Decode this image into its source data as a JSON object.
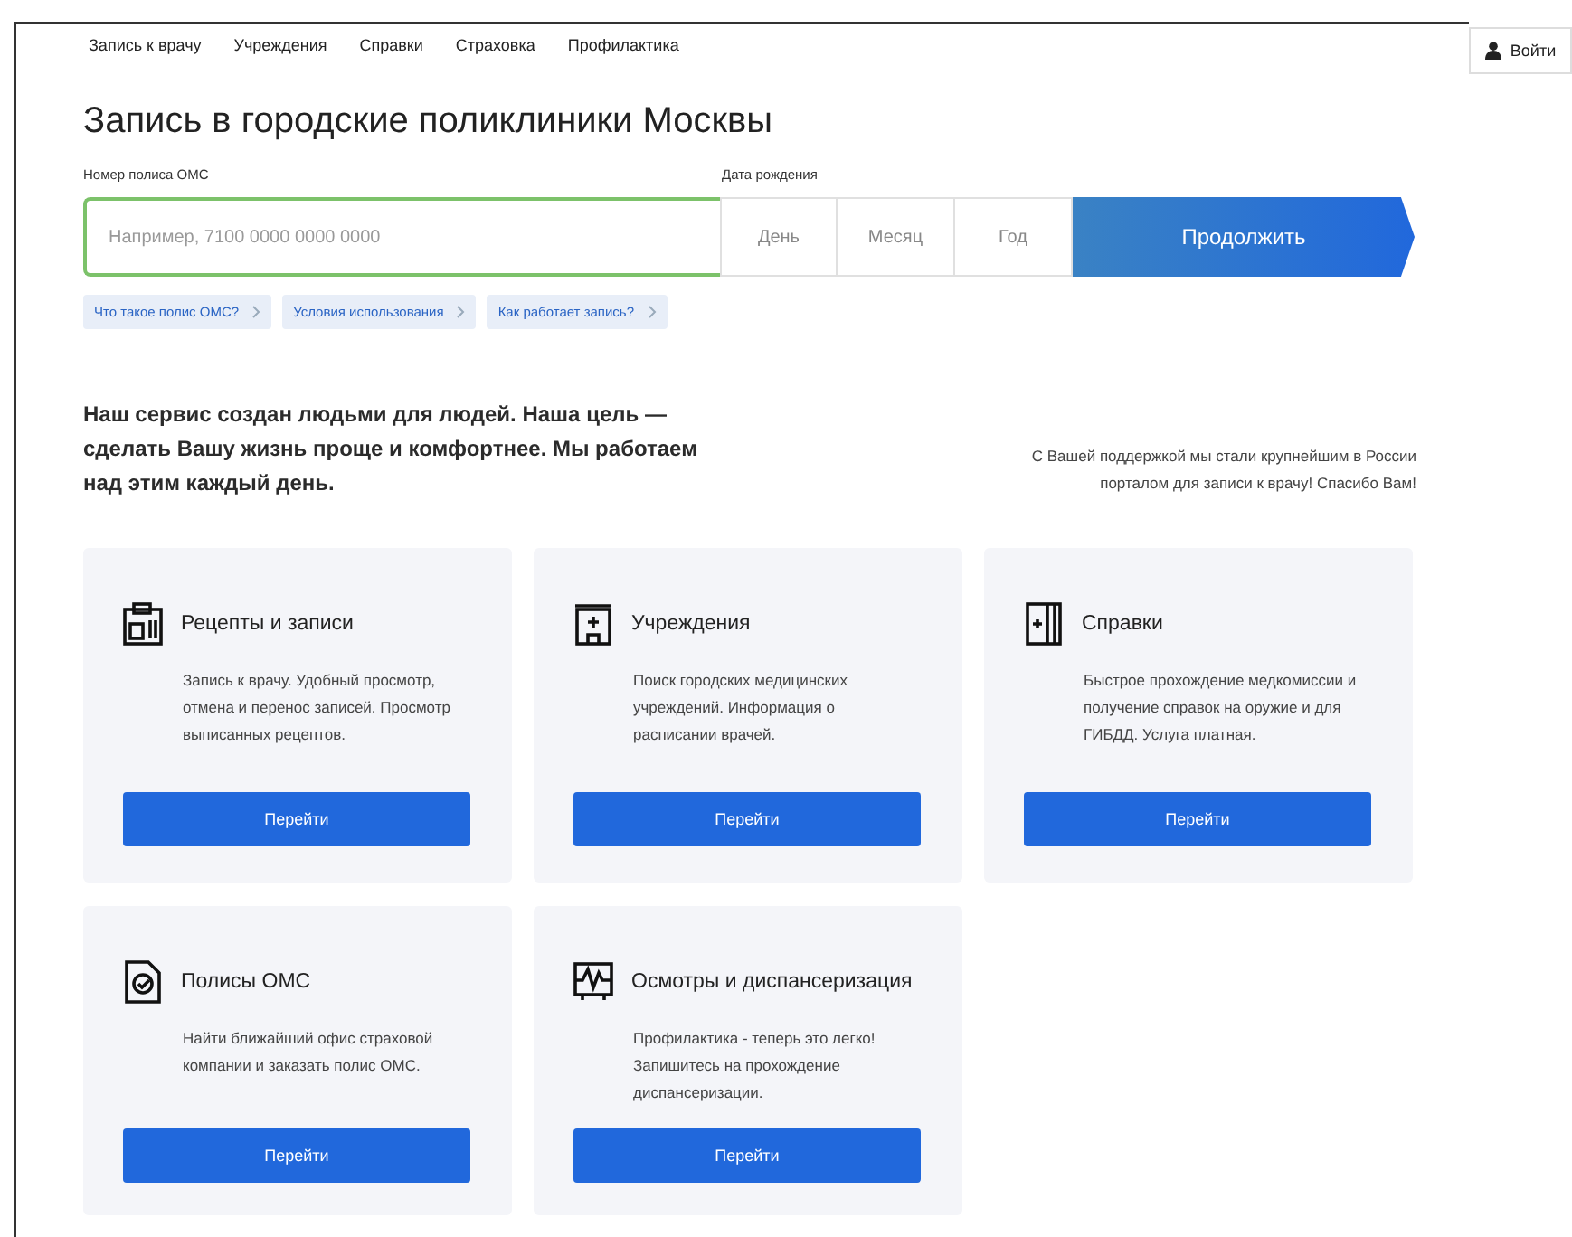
{
  "nav": {
    "items": [
      "Запись к врачу",
      "Учреждения",
      "Справки",
      "Страховка",
      "Профилактика"
    ],
    "login": "Войти"
  },
  "title": "Запись в городские поликлиники Москвы",
  "form": {
    "policy_label": "Номер полиса ОМС",
    "policy_placeholder": "Например, 7100 0000 0000 0000",
    "birth_label": "Дата рождения",
    "day_placeholder": "День",
    "month_placeholder": "Месяц",
    "year_placeholder": "Год",
    "submit": "Продолжить"
  },
  "help_links": [
    "Что такое полис ОМС?",
    "Условия использования",
    "Как работает запись?"
  ],
  "intro": "Наш сервис создан людьми для людей. Наша цель — сделать Вашу жизнь проще и комфортнее. Мы работаем над этим каждый день.",
  "thanks": "С Вашей поддержкой мы стали крупнейшим в России порталом для записи к врачу! Спасибо Вам!",
  "cards": [
    {
      "title": "Рецепты и записи",
      "text": "Запись к врачу. Удобный просмотр, отмена и перенос записей. Просмотр выписанных рецептов.",
      "button": "Перейти"
    },
    {
      "title": "Учреждения",
      "text": "Поиск городских медицинских учреждений. Информация о расписании врачей.",
      "button": "Перейти"
    },
    {
      "title": "Справки",
      "text": "Быстрое прохождение медкомиссии и получение справок на оружие и для ГИБДД. Услуга платная.",
      "button": "Перейти"
    },
    {
      "title": "Полисы ОМС",
      "text": "Найти ближайший офис страховой компании и заказать полис ОМС.",
      "button": "Перейти"
    },
    {
      "title": "Осмотры и диспансеризация",
      "text": "Профилактика - теперь это легко! Запишитесь на прохождение диспансеризации.",
      "button": "Перейти"
    }
  ]
}
